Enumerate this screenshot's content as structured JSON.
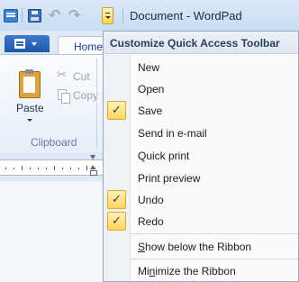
{
  "window": {
    "title": "Document - WordPad"
  },
  "quick_access": {
    "icons": [
      "wordpad-app-icon",
      "save-icon",
      "undo-icon",
      "redo-icon",
      "customize-dropdown-icon"
    ],
    "undo_glyph": "↶",
    "redo_glyph": "↷"
  },
  "ribbon": {
    "home_tab": "Home",
    "clipboard": {
      "paste": "Paste",
      "cut": "Cut",
      "copy": "Copy",
      "group_label": "Clipboard",
      "cut_glyph": "✂"
    }
  },
  "menu": {
    "title": "Customize Quick Access Toolbar",
    "check_glyph": "✓",
    "items": [
      {
        "label": "New",
        "checked": false
      },
      {
        "label": "Open",
        "checked": false
      },
      {
        "label": "Save",
        "checked": true
      },
      {
        "label": "Send in e-mail",
        "checked": false
      },
      {
        "label": "Quick print",
        "checked": false
      },
      {
        "label": "Print preview",
        "checked": false
      },
      {
        "label": "Undo",
        "checked": true
      },
      {
        "label": "Redo",
        "checked": true
      }
    ],
    "show_below": {
      "accel": "S",
      "rest": "how below the Ribbon"
    },
    "minimize": {
      "pre": "Mi",
      "accel": "n",
      "rest": "imize the Ribbon"
    }
  },
  "colors": {
    "titlebar": "#dbe8f7",
    "checkbox_highlight": "#ffd45c",
    "app_button": "#2a63b8"
  }
}
